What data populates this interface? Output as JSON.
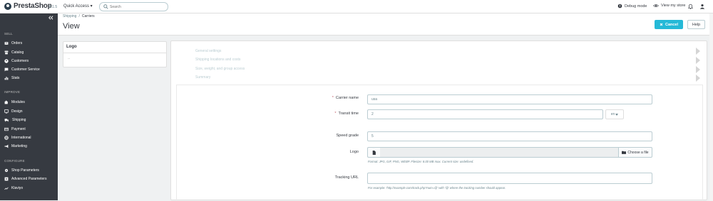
{
  "header": {
    "logo_text": "PrestaShop",
    "version": "8.1.5",
    "quick_access": "Quick Access ▾",
    "search_placeholder": "Search",
    "debug_mode": "Debug mode",
    "view_store": "View my store"
  },
  "sidebar": {
    "sections": [
      {
        "title": "SELL",
        "items": [
          {
            "label": "Orders",
            "icon": "inbox-icon"
          },
          {
            "label": "Catalog",
            "icon": "store-icon"
          },
          {
            "label": "Customers",
            "icon": "account-circle-icon"
          },
          {
            "label": "Customer Service",
            "icon": "chat-icon"
          },
          {
            "label": "Stats",
            "icon": "bar-chart-icon"
          }
        ]
      },
      {
        "title": "IMPROVE",
        "items": [
          {
            "label": "Modules",
            "icon": "puzzle-icon"
          },
          {
            "label": "Design",
            "icon": "desktop-icon"
          },
          {
            "label": "Shipping",
            "icon": "truck-icon"
          },
          {
            "label": "Payment",
            "icon": "credit-card-icon"
          },
          {
            "label": "International",
            "icon": "globe-icon"
          },
          {
            "label": "Marketing",
            "icon": "megaphone-icon"
          }
        ]
      },
      {
        "title": "CONFIGURE",
        "items": [
          {
            "label": "Shop Parameters",
            "icon": "settings-icon"
          },
          {
            "label": "Advanced Parameters",
            "icon": "settings-app-icon"
          },
          {
            "label": "Klaviyo",
            "icon": "trending-icon"
          }
        ]
      }
    ]
  },
  "breadcrumb": {
    "parent": "Shipping",
    "separator": "/",
    "current": "Carriers"
  },
  "page_title": "View",
  "toolbar": {
    "cancel_label": "Cancel",
    "help_label": "Help"
  },
  "logo_panel": {
    "title": "Logo",
    "body": "--"
  },
  "wizard_steps": [
    "General settings",
    "Shipping locations and costs",
    "Size, weight, and group access",
    "Summary"
  ],
  "form": {
    "carrier_name": {
      "label": "Carrier name",
      "value": "usa"
    },
    "transit_time": {
      "label": "Transit time",
      "value": "2",
      "lang": "en"
    },
    "speed_grade": {
      "label": "Speed grade",
      "value": "5"
    },
    "logo": {
      "label": "Logo",
      "button": "Choose a file",
      "help": "Format: JPG, GIF, PNG, WEBP. Filesize: 8.00 MB max. Current size: undefined."
    },
    "tracking_url": {
      "label": "Tracking URL",
      "value": "",
      "help": "For example: 'http://example.com/track.php?num=@' with '@' where the tracking number should appear."
    }
  },
  "colors": {
    "accent": "#25b9d7",
    "sidebar": "#363a41",
    "required": "#c05c67"
  }
}
